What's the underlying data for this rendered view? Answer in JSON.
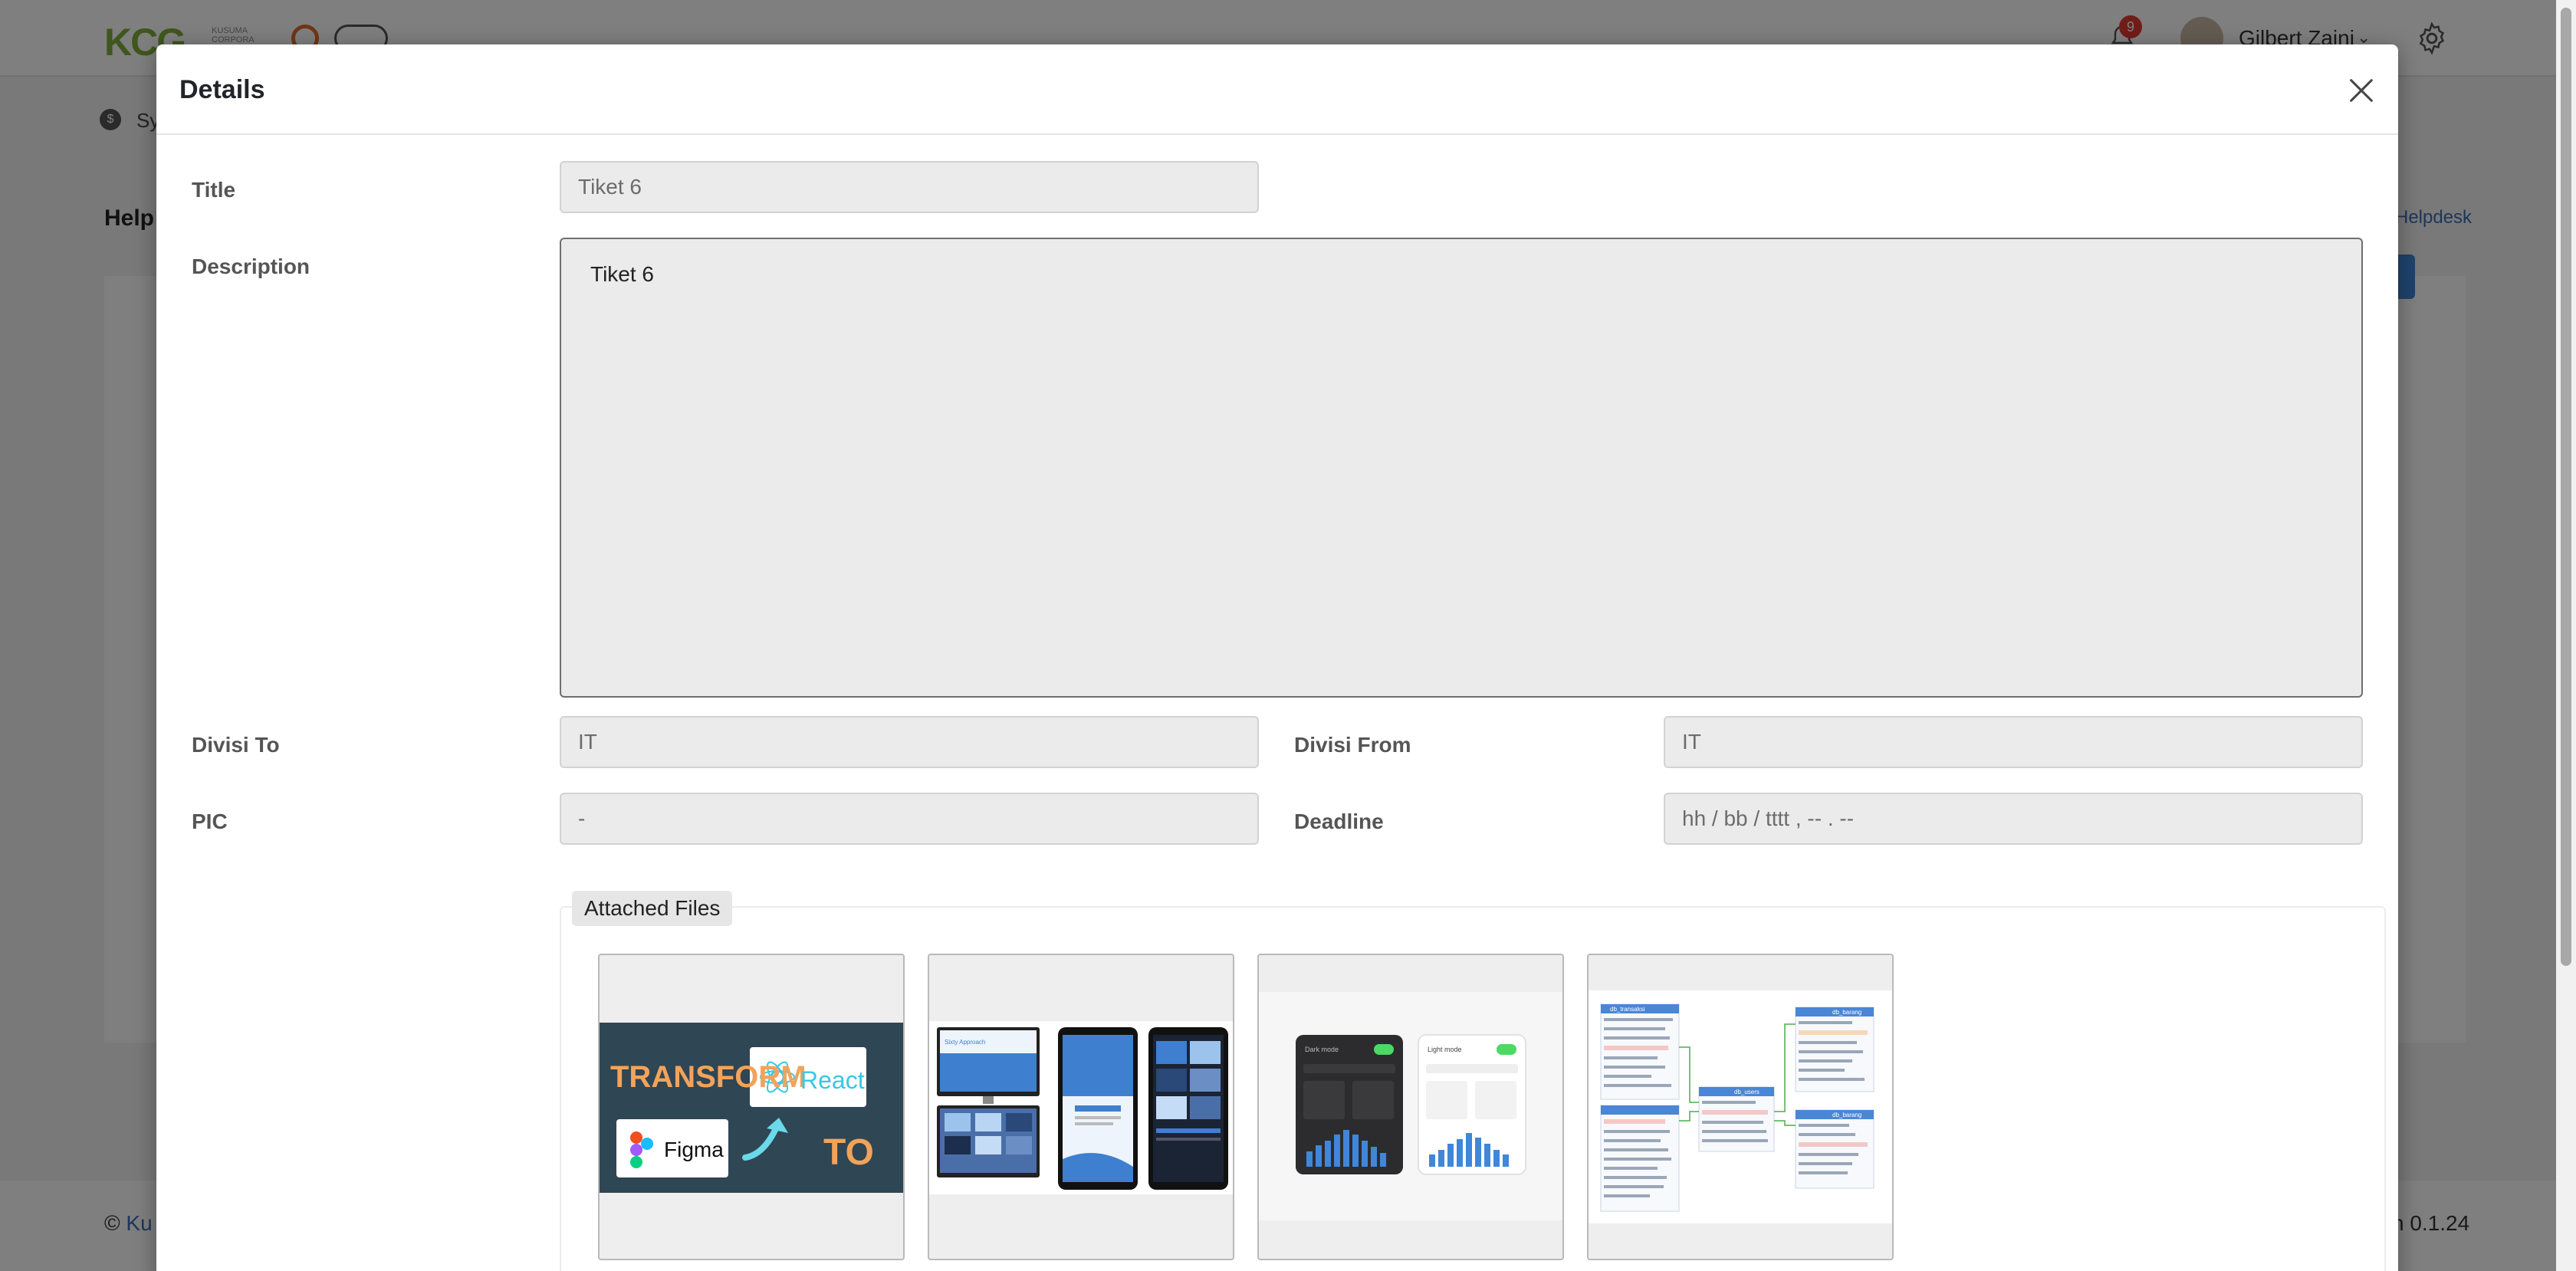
{
  "background": {
    "logo": "KCG",
    "logo_sub": "KUSUMA CORPORA",
    "notifications_count": "9",
    "user_name": "Gilbert Zaini",
    "breadcrumb": "Sy",
    "page_heading": "Help",
    "breadcrumb_right": "Helpdesk",
    "footer_left_prefix": "©",
    "footer_left_link": "Ku",
    "footer_right": "n 0.1.24"
  },
  "modal": {
    "title": "Details",
    "fields": {
      "title_label": "Title",
      "title_value": "Tiket 6",
      "description_label": "Description",
      "description_value": "Tiket 6",
      "divisi_to_label": "Divisi To",
      "divisi_to_value": "IT",
      "divisi_from_label": "Divisi From",
      "divisi_from_value": "IT",
      "pic_label": "PIC",
      "pic_value": "-",
      "deadline_label": "Deadline",
      "deadline_placeholder": "hh / bb / tttt ,  -- . --"
    },
    "attached_files_label": "Attached Files",
    "attachments": [
      {
        "caption_1": "TRANSFORM",
        "caption_2": "React",
        "caption_3": "Figma",
        "caption_4": "TO"
      },
      {
        "caption_1": "Sixty Approach"
      },
      {
        "caption_1": "Dark mode",
        "caption_2": "Light mode"
      },
      {
        "caption_1": "db_transaksi",
        "caption_2": "db_barang",
        "caption_3": "db_users",
        "caption_4": "db_barang"
      }
    ]
  },
  "colors": {
    "accent": "#3f87d9",
    "logo_green": "#7fae3a",
    "badge_red": "#e53935"
  }
}
